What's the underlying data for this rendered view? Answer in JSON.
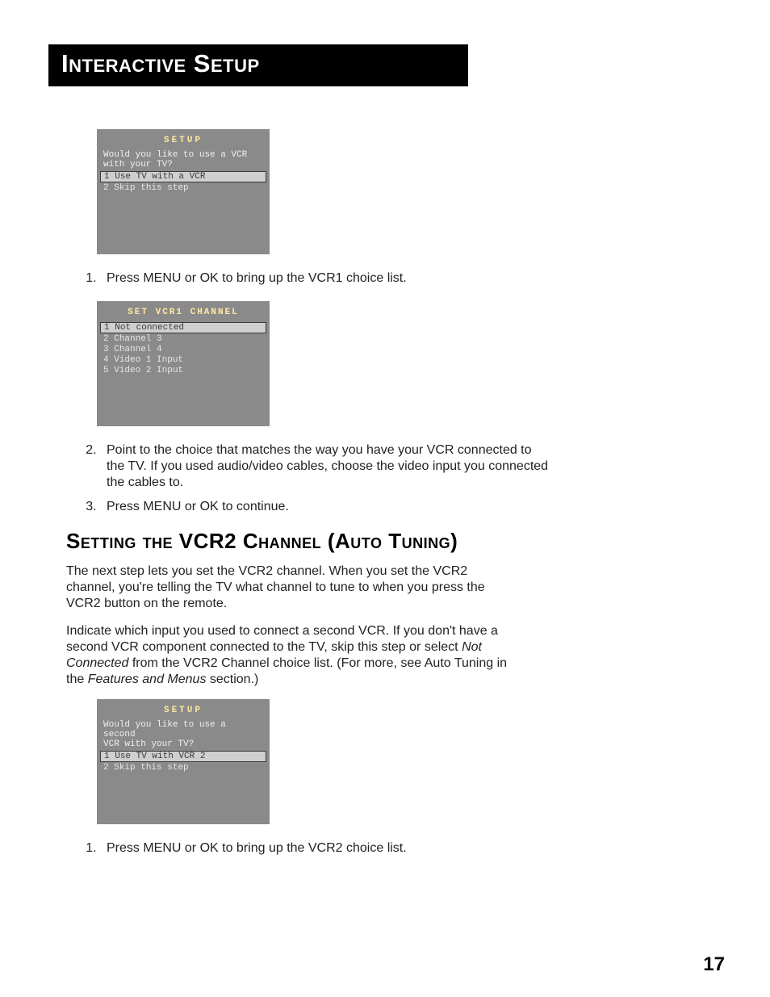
{
  "header": {
    "title": "Interactive Setup"
  },
  "osd1": {
    "title": "SETUP",
    "question": "Would you like to use a VCR\nwith your TV?",
    "items": [
      {
        "n": "1",
        "label": "Use TV with a VCR",
        "selected": true
      },
      {
        "n": "2",
        "label": "Skip this step",
        "selected": false
      }
    ]
  },
  "steps1": [
    "Press MENU or OK to bring up the VCR1 choice list."
  ],
  "osd2": {
    "title": "SET VCR1 CHANNEL",
    "items": [
      {
        "n": "1",
        "label": "Not connected",
        "selected": true
      },
      {
        "n": "2",
        "label": "Channel 3",
        "selected": false
      },
      {
        "n": "3",
        "label": "Channel 4",
        "selected": false
      },
      {
        "n": "4",
        "label": "Video 1 Input",
        "selected": false
      },
      {
        "n": "5",
        "label": "Video 2 Input",
        "selected": false
      }
    ]
  },
  "steps2": [
    "Point to the choice that matches the way you have your VCR connected to the TV. If you used audio/video cables, choose the video input you connected the cables to.",
    "Press MENU or OK to continue."
  ],
  "section2": {
    "heading": "Setting the VCR2 Channel (Auto Tuning)",
    "para1": "The next step lets you set the VCR2 channel. When you set the VCR2 channel, you're telling the TV what channel to tune to when you press the VCR2 button on the remote.",
    "para2_a": "Indicate which input you used to connect a second VCR.  If you don't have a second VCR component connected to the TV, skip this step or select ",
    "para2_em1": "Not Connected",
    "para2_b": " from the VCR2 Channel choice list. (For more, see Auto Tuning in the ",
    "para2_em2": "Features and Menus",
    "para2_c": " section.)"
  },
  "osd3": {
    "title": "SETUP",
    "question": "Would you like to use a second\nVCR with your TV?",
    "items": [
      {
        "n": "1",
        "label": "Use TV with VCR 2",
        "selected": true
      },
      {
        "n": "2",
        "label": "Skip this step",
        "selected": false
      }
    ]
  },
  "steps3": [
    "Press MENU or OK to bring up the VCR2 choice list."
  ],
  "page_number": "17"
}
